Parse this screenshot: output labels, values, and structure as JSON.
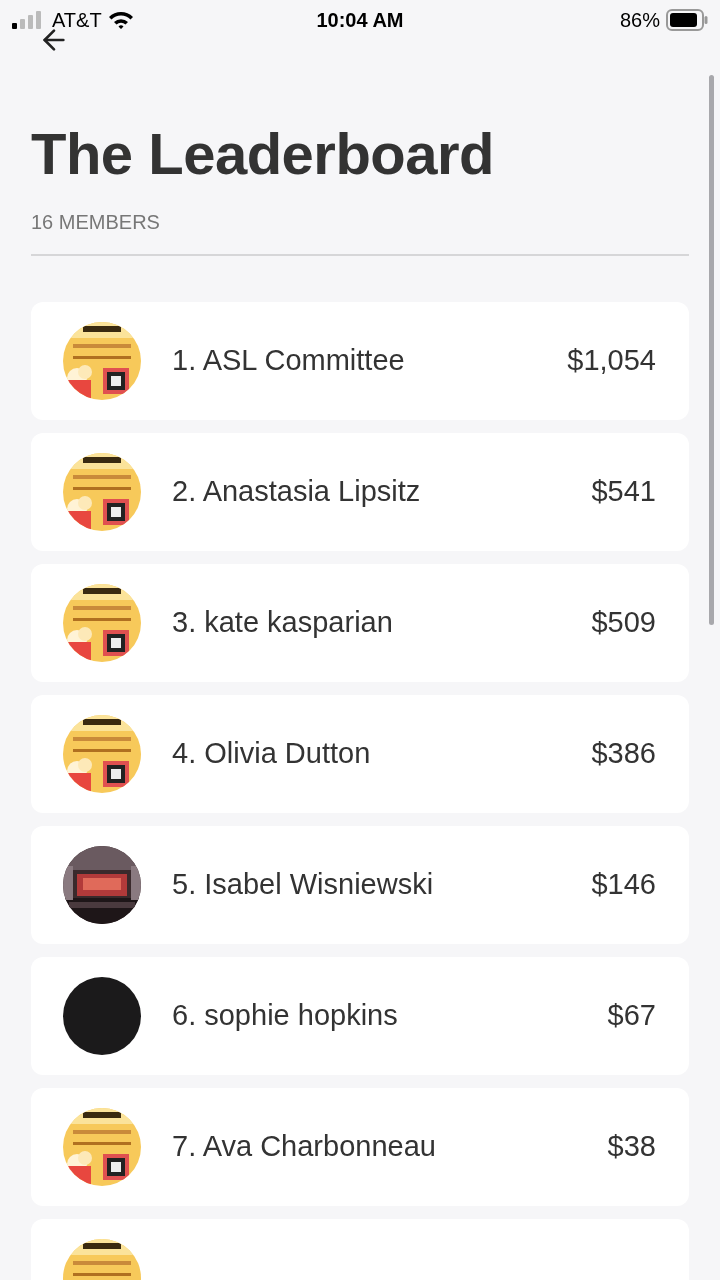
{
  "status_bar": {
    "carrier": "AT&T",
    "time": "10:04 AM",
    "battery": "86%"
  },
  "title": "The Leaderboard",
  "member_count": "16 MEMBERS",
  "members": [
    {
      "name": "1. ASL Committee",
      "amount": "$1,054",
      "avatar": {
        "kind": "poster"
      }
    },
    {
      "name": "2. Anastasia Lipsitz",
      "amount": "$541",
      "avatar": {
        "kind": "poster"
      }
    },
    {
      "name": "3. kate kasparian",
      "amount": "$509",
      "avatar": {
        "kind": "poster"
      }
    },
    {
      "name": "4. Olivia Dutton",
      "amount": "$386",
      "avatar": {
        "kind": "poster"
      }
    },
    {
      "name": "5. Isabel Wisniewski",
      "amount": "$146"
    },
    {
      "name": "6. sophie hopkins",
      "amount": "$67",
      "avatar": {
        "kind": "plain"
      }
    },
    {
      "name": "7. Ava Charbonneau",
      "amount": "$38",
      "avatar": {
        "kind": "poster"
      }
    }
  ],
  "partial_card": {
    "avatar": {
      "kind": "poster"
    }
  }
}
